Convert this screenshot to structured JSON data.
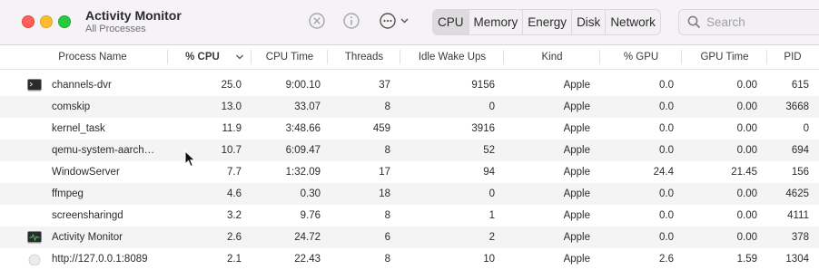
{
  "window": {
    "title": "Activity Monitor",
    "subtitle": "All Processes",
    "tabs": [
      "CPU",
      "Memory",
      "Energy",
      "Disk",
      "Network"
    ],
    "active_tab": "CPU",
    "search_placeholder": "Search"
  },
  "icons": {
    "stop": "stop-process-icon",
    "info": "info-icon",
    "more": "more-actions-icon",
    "search": "search-icon",
    "sort": "chevron-down-icon",
    "cursor": "mouse-pointer-icon"
  },
  "colors": {
    "close": "#fe5f57",
    "minimize": "#febc2e",
    "zoom": "#28c840",
    "row_alt": "#f4f4f5"
  },
  "table": {
    "columns": [
      "Process Name",
      "% CPU",
      "CPU Time",
      "Threads",
      "Idle Wake Ups",
      "Kind",
      "% GPU",
      "GPU Time",
      "PID"
    ],
    "sorted_column": "% CPU",
    "rows": [
      {
        "name": "channels-dvr",
        "icon": "terminal-icon",
        "cpu": "25.0",
        "cpu_time": "9:00.10",
        "threads": "37",
        "wakeups": "9156",
        "kind": "Apple",
        "gpu": "0.0",
        "gpu_time": "0.00",
        "pid": "615"
      },
      {
        "name": "comskip",
        "icon": "",
        "cpu": "13.0",
        "cpu_time": "33.07",
        "threads": "8",
        "wakeups": "0",
        "kind": "Apple",
        "gpu": "0.0",
        "gpu_time": "0.00",
        "pid": "3668"
      },
      {
        "name": "kernel_task",
        "icon": "",
        "cpu": "11.9",
        "cpu_time": "3:48.66",
        "threads": "459",
        "wakeups": "3916",
        "kind": "Apple",
        "gpu": "0.0",
        "gpu_time": "0.00",
        "pid": "0"
      },
      {
        "name": "qemu-system-aarch…",
        "icon": "",
        "cpu": "10.7",
        "cpu_time": "6:09.47",
        "threads": "8",
        "wakeups": "52",
        "kind": "Apple",
        "gpu": "0.0",
        "gpu_time": "0.00",
        "pid": "694"
      },
      {
        "name": "WindowServer",
        "icon": "",
        "cpu": "7.7",
        "cpu_time": "1:32.09",
        "threads": "17",
        "wakeups": "94",
        "kind": "Apple",
        "gpu": "24.4",
        "gpu_time": "21.45",
        "pid": "156"
      },
      {
        "name": "ffmpeg",
        "icon": "",
        "cpu": "4.6",
        "cpu_time": "0.30",
        "threads": "18",
        "wakeups": "0",
        "kind": "Apple",
        "gpu": "0.0",
        "gpu_time": "0.00",
        "pid": "4625"
      },
      {
        "name": "screensharingd",
        "icon": "",
        "cpu": "3.2",
        "cpu_time": "9.76",
        "threads": "8",
        "wakeups": "1",
        "kind": "Apple",
        "gpu": "0.0",
        "gpu_time": "0.00",
        "pid": "4111"
      },
      {
        "name": "Activity Monitor",
        "icon": "activity-monitor-icon",
        "cpu": "2.6",
        "cpu_time": "24.72",
        "threads": "6",
        "wakeups": "2",
        "kind": "Apple",
        "gpu": "0.0",
        "gpu_time": "0.00",
        "pid": "378"
      },
      {
        "name": "http://127.0.0.1:8089",
        "icon": "web-content-icon",
        "cpu": "2.1",
        "cpu_time": "22.43",
        "threads": "8",
        "wakeups": "10",
        "kind": "Apple",
        "gpu": "2.6",
        "gpu_time": "1.59",
        "pid": "1304"
      }
    ]
  }
}
